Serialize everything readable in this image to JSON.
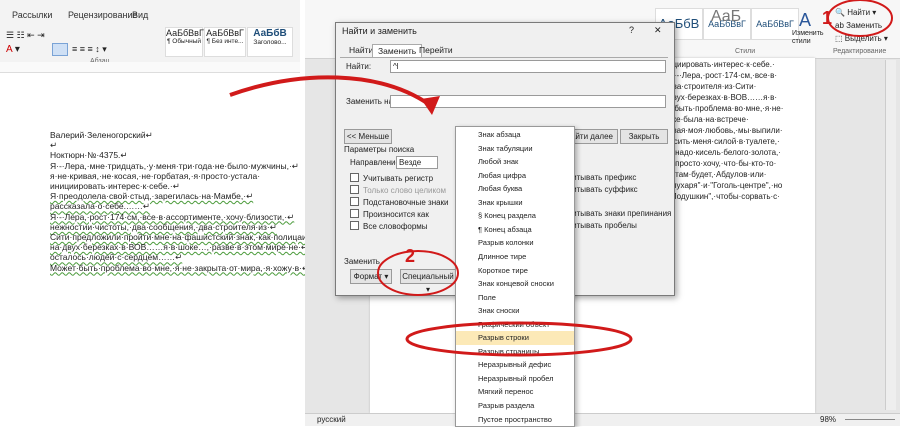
{
  "left_ribbon": {
    "tabs": [
      "Рассылки",
      "Рецензирование",
      "Вид"
    ],
    "styles": [
      {
        "sample": "АаБбВвГ",
        "label": "¶ Обычный"
      },
      {
        "sample": "АаБбВвГ",
        "label": "¶ Без инте..."
      },
      {
        "sample": "АаБбВ",
        "label": "Заголово..."
      }
    ],
    "group_label": "Абзац"
  },
  "document_lines": [
    "Валерий·Зеленогорский↵",
    "↵",
    "Ноктюрн·№·4375.↵",
    "Я·-·Лера,·мне·тридцать,·у·меня·три·года·не·было·мужчины,·↵",
    "я·не·кривая,·не·косая,·не·горбатая,·я·просто·устала·",
    "инициировать·интерес·к·себе.·↵",
    "Я·преодолела·свой·стыд,·зарегилась·на·Мамбе,·↵",
    "рассказала·о·себе.……↵",
    "Я·-·Лера,·рост·174·см,·все·в·ассортименте,·хочу·близости,·↵",
    "нежностии·чистоты,·два·сообщения,·два·строителя·из·↵",
    "Сити·предложили·пройти·мне·на·фашистский·знак,·как·полицаи·↵",
    "на·двух·березках·в·ВОВ……я·в·шоке…,·разве·в·этом·мире·не·↵",
    "осталось·людей·с·сердцем……↵",
    "Может·быть·проблема·во·мне,·я·не·закрыта·от·мира,·я·хожу·в·↵"
  ],
  "right_ribbon": {
    "styles": [
      "АаБбВ",
      "АаБбВвГ",
      "АаБбВвГ",
      "АаБ"
    ],
    "change_styles": "Изменить стили",
    "styles_group": "Стили",
    "find": "Найти",
    "replace": "Заменить",
    "select": "Выделить",
    "editing_group": "Редактирование"
  },
  "page_right_lines": [
    "ициировать·интерес·к·себе.·",
    "Я·-·Лера,·рост·174·см,·все·в·",
    "два·строителя·из·Сити·",
    "двух·березках·в·ВОВ……я·в·",
    "т·быть·проблема·во·мне,·я·не·",
    "бке·была·на·встрече·",
    "рвая·моя·любовь,·мы·выпили·",
    "ысить·меня·силой·в·туалете,·",
    "е·надо·кисель·белого·золота,·",
    "е·просто·хочу,·что·бы·кто-то·",
    "о·там·будет,·Абдулов·или·",
    "Глухаря\"·и·\"Гоголь-центре\",·но",
    "\"Подушкин\",·чтобы·сорвать·с·"
  ],
  "dialog": {
    "title": "Найти и заменить",
    "help": "?",
    "close": "✕",
    "tabs": [
      "Найти",
      "Заменить",
      "Перейти"
    ],
    "find_label": "Найти:",
    "find_value": "^l",
    "replace_label": "Заменить на:",
    "less_button": "<< Меньше",
    "find_next": "айти далее",
    "cancel": "Закрыть",
    "search_params": "Параметры поиска",
    "direction_label": "Направление:",
    "direction_value": "Везде",
    "checkboxes_left": [
      "Учитывать регистр",
      "Только слово целиком",
      "Подстановочные знаки",
      "Произносится как",
      "Все словоформы"
    ],
    "checkboxes_right": [
      "читывать префикс",
      "читывать суффикс",
      "читывать знаки препинания",
      "читывать пробелы"
    ],
    "replace_section": "Заменить",
    "format_button": "Формат ▾",
    "special_button": "Специальный ▾"
  },
  "special_menu": [
    "Знак абзаца",
    "Знак табуляции",
    "Любой знак",
    "Любая цифра",
    "Любая буква",
    "Знак крышки",
    "§ Конец раздела",
    "¶ Конец абзаца",
    "Разрыв колонки",
    "Длинное тире",
    "Короткое тире",
    "Знак концевой сноски",
    "Поле",
    "Знак сноски",
    "Графический объект",
    "Разрыв строки",
    "Разрыв страницы",
    "Неразрывный дефис",
    "Неразрывный пробел",
    "Мягкий перенос",
    "Разрыв раздела",
    "Пустое пространство"
  ],
  "highlighted_item_index": 15,
  "status": {
    "language": "русский",
    "zoom": "98%"
  },
  "annotations": {
    "marker1": "1",
    "marker2": "2"
  },
  "colors": {
    "annotation_red": "#d11a1a",
    "highlight": "#fce9b7",
    "word_blue": "#2b579a"
  }
}
